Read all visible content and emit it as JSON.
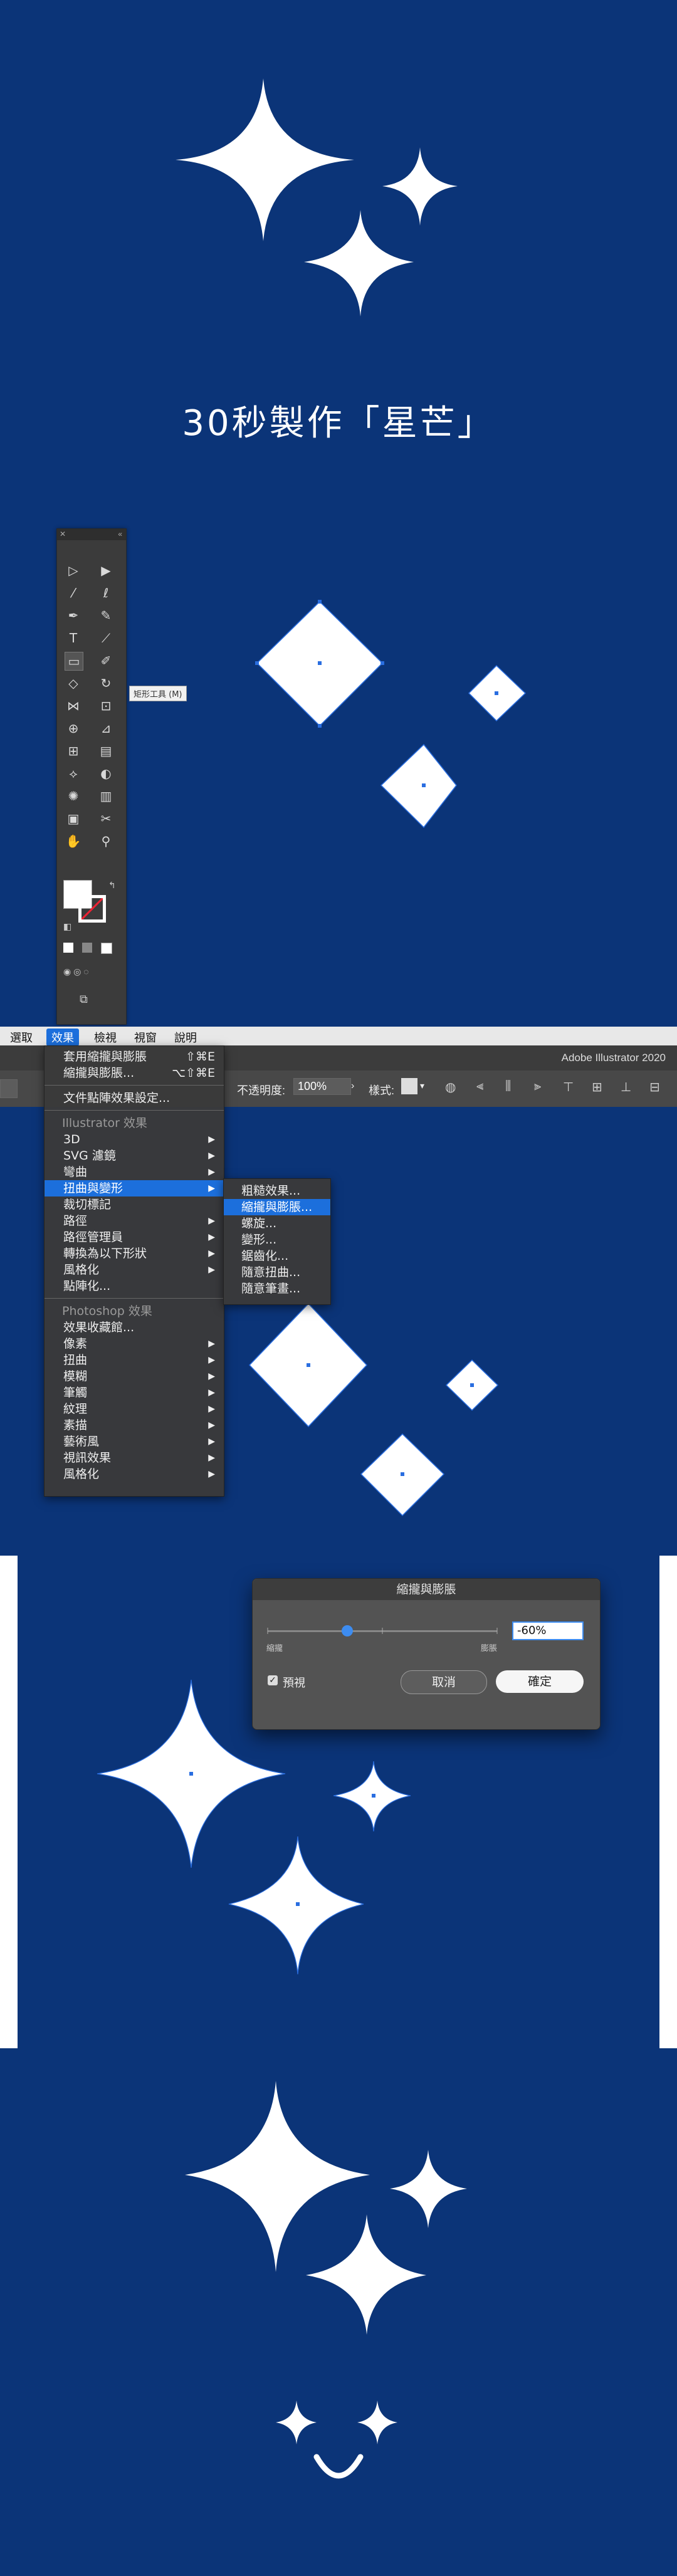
{
  "title": "30秒製作「星芒」",
  "tooltip": "矩形工具 (M)",
  "menubar": {
    "items": [
      "選取",
      "效果",
      "檢視",
      "視窗",
      "說明"
    ],
    "active_index": 1
  },
  "app_name": "Adobe Illustrator 2020",
  "control_bar": {
    "opacity_label": "不透明度:",
    "opacity_value": "100%",
    "style_label": "樣式:"
  },
  "effect_menu": {
    "apply_last": "套用縮攏與膨脹",
    "apply_last_shortcut": "⇧⌘E",
    "last_effect": "縮攏與膨脹...",
    "last_effect_shortcut": "⌥⇧⌘E",
    "document_raster": "文件點陣效果設定...",
    "illustrator_group": "Illustrator 效果",
    "illustrator_items": [
      "3D",
      "SVG 濾鏡",
      "彎曲",
      "扭曲與變形",
      "裁切標記",
      "路徑",
      "路徑管理員",
      "轉換為以下形狀",
      "風格化",
      "點陣化..."
    ],
    "photoshop_group": "Photoshop 效果",
    "photoshop_items": [
      "效果收藏館...",
      "像素",
      "扭曲",
      "模糊",
      "筆觸",
      "紋理",
      "素描",
      "藝術風",
      "視訊效果",
      "風格化"
    ]
  },
  "distort_submenu": [
    "粗糙效果...",
    "縮攏與膨脹...",
    "螺旋...",
    "變形...",
    "鋸齒化...",
    "隨意扭曲...",
    "隨意筆畫..."
  ],
  "dialog": {
    "title": "縮攏與膨脹",
    "left_label": "縮攏",
    "right_label": "膨脹",
    "value": "-60%",
    "value_fraction": -0.6,
    "preview_label": "預視",
    "preview_checked": true,
    "cancel": "取消",
    "ok": "確定"
  },
  "colors": {
    "background": "#0b3478",
    "star": "#ffffff",
    "highlight": "#1c6fdc",
    "selection": "#2a6ee0"
  },
  "icons": [
    "close-icon",
    "selection-tool-icon",
    "direct-selection-icon",
    "magic-wand-icon",
    "lasso-icon",
    "pen-tool-icon",
    "type-tool-icon",
    "line-tool-icon",
    "rectangle-tool-icon",
    "zoom-icon",
    "hand-icon",
    "checkbox-icon",
    "smiley-icon"
  ]
}
